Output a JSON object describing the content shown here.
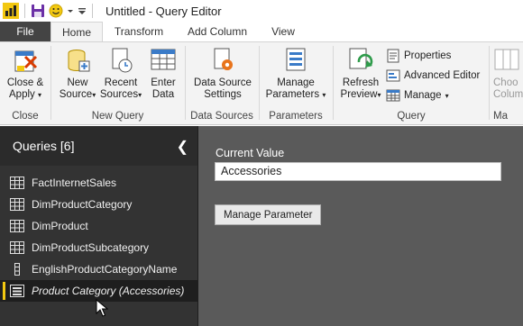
{
  "window": {
    "title": "Untitled - Query Editor"
  },
  "tabs": [
    "File",
    "Home",
    "Transform",
    "Add Column",
    "View"
  ],
  "ribbon": {
    "close_group": {
      "label": "Close",
      "close_apply_line1": "Close &",
      "close_apply_line2": "Apply"
    },
    "new_query_group": {
      "label": "New Query",
      "new_source_line1": "New",
      "new_source_line2": "Source",
      "recent_sources_line1": "Recent",
      "recent_sources_line2": "Sources",
      "enter_data_line1": "Enter",
      "enter_data_line2": "Data"
    },
    "data_sources_group": {
      "label": "Data Sources",
      "settings_line1": "Data Source",
      "settings_line2": "Settings"
    },
    "parameters_group": {
      "label": "Parameters",
      "manage_line1": "Manage",
      "manage_line2": "Parameters"
    },
    "query_group": {
      "label": "Query",
      "refresh_line1": "Refresh",
      "refresh_line2": "Preview",
      "properties": "Properties",
      "advanced_editor": "Advanced Editor",
      "manage": "Manage"
    },
    "cut_group": {
      "choose_line1": "Choo",
      "choose_line2": "Colum",
      "label": "Ma"
    }
  },
  "queries": {
    "title": "Queries [6]",
    "items": [
      {
        "label": "FactInternetSales",
        "icon": "table-icon"
      },
      {
        "label": "DimProductCategory",
        "icon": "table-icon"
      },
      {
        "label": "DimProduct",
        "icon": "table-icon"
      },
      {
        "label": "DimProductSubcategory",
        "icon": "table-icon"
      },
      {
        "label": "EnglishProductCategoryName",
        "icon": "list-icon"
      },
      {
        "label": "Product Category (Accessories)",
        "icon": "parameter-icon",
        "selected": true
      }
    ]
  },
  "parameter": {
    "current_value_label": "Current Value",
    "current_value": "Accessories",
    "manage_button": "Manage Parameter"
  },
  "colors": {
    "accent_selected": "#f2c811",
    "pane_dark": "#333333",
    "main_pane": "#5a5a5a",
    "file_tab": "#444444"
  }
}
